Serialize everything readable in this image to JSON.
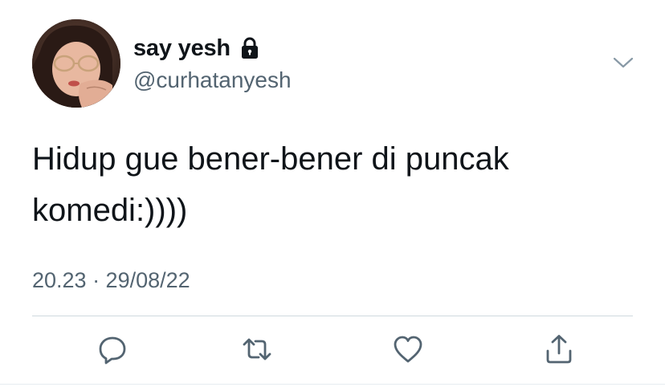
{
  "user": {
    "display_name": "say yesh",
    "handle": "@curhatanyesh",
    "lock_icon": "lock-icon",
    "avatar_icon": "avatar"
  },
  "tweet": {
    "text": "Hidup gue bener-bener di puncak\nkomedi:))))",
    "timestamp": "20.23 · 29/08/22"
  },
  "actions": [
    {
      "name": "reply-icon"
    },
    {
      "name": "retweet-icon"
    },
    {
      "name": "like-icon"
    },
    {
      "name": "share-icon"
    }
  ],
  "colors": {
    "text_primary": "#0f1419",
    "text_secondary": "#536471",
    "icon": "#536471",
    "divider": "#cfd9de"
  }
}
